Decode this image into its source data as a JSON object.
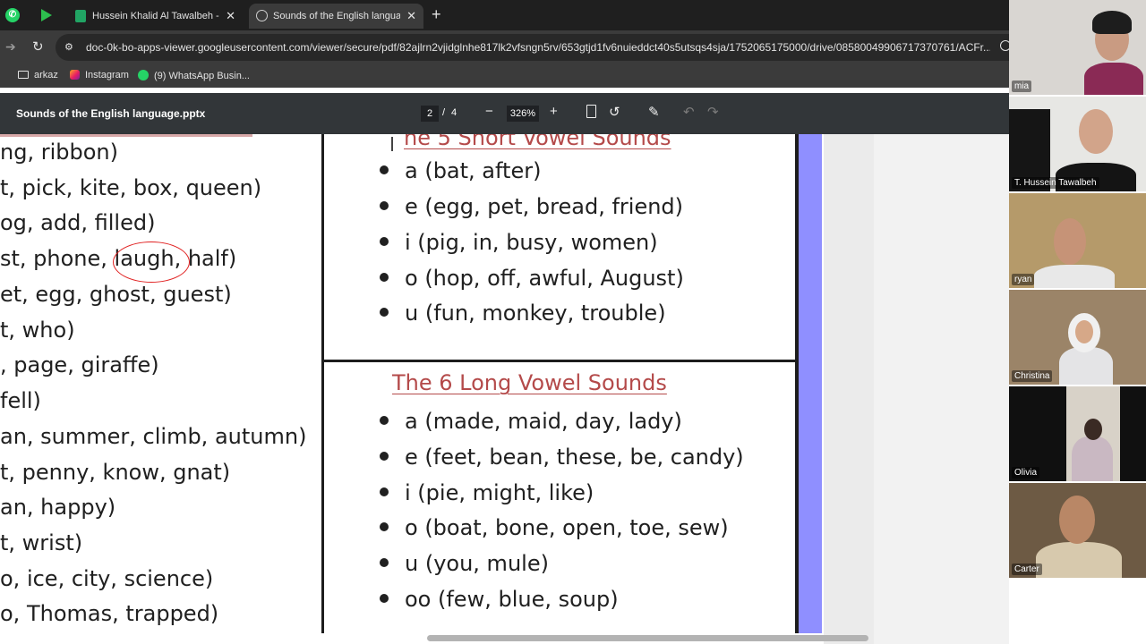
{
  "browser": {
    "tabs": [
      {
        "title": "Hussein Khalid Al Tawalbeh - G",
        "active": false
      },
      {
        "title": "Sounds of the English language",
        "active": true
      }
    ],
    "url": "doc-0k-bo-apps-viewer.googleusercontent.com/viewer/secure/pdf/82ajlrn2vjidglnhe817lk2vfsngn5rv/653gtjd1fv6nuieddct40s5utsqs4sja/1752065175000/drive/08580049906717370761/ACFr...",
    "bookmarks": [
      "arkaz",
      "Instagram",
      "(9) WhatsApp Busin..."
    ]
  },
  "pdf": {
    "file_name": "Sounds of the English language.pptx",
    "current_page": "2",
    "page_sep": "/",
    "total_pages": "4",
    "zoom": "326%"
  },
  "slide": {
    "left_lines": [
      "ng, ribbon)",
      "t, pick, kite, box, queen)",
      "og, add, filled)",
      "st, phone, ",
      "laugh",
      ", half)",
      "et, egg, ghost, guest)",
      "t, who)",
      ", page, giraffe)",
      " fell)",
      "an, summer, climb, autumn)",
      "t, penny, know, gnat)",
      "an, happy)",
      "t, wrist)",
      "o, ice, city, science)",
      "o, Thomas, trapped)"
    ],
    "short_heading": "he 5 Short Vowel Sounds",
    "short_items": [
      "a (bat, after)",
      "e (egg, pet, bread, friend)",
      "i (pig, in, busy, women)",
      "o (hop, off, awful, August)",
      "u (fun, monkey, trouble)"
    ],
    "long_heading": "The 6 Long Vowel Sounds",
    "long_items": [
      "a (made, maid, day, lady)",
      "e (feet, bean, these, be, candy)",
      "i (pie, might, like)",
      "o (boat, bone, open, toe, sew)",
      "u (you, mule)",
      "oo (few, blue, soup)"
    ]
  },
  "participants": [
    "mia",
    "T. Hussein Tawalbeh",
    "ryan",
    "Christina",
    "Olivia",
    "Carter"
  ],
  "colors": {
    "heading": "#b44a4a",
    "purple_bar": "#8f8fff",
    "circle": "#e02020"
  }
}
